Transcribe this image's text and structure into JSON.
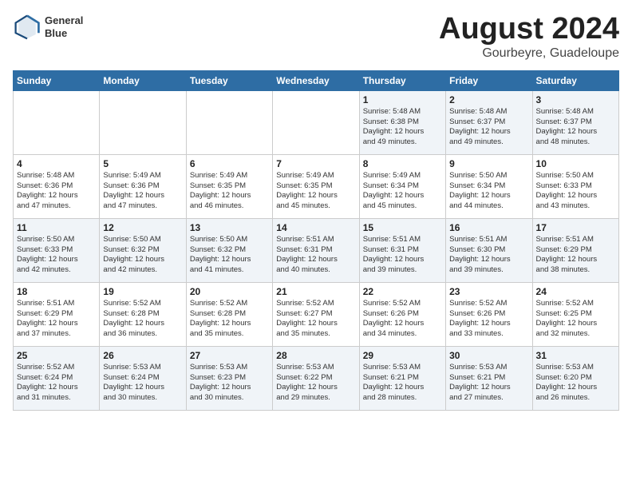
{
  "header": {
    "logo_line1": "General",
    "logo_line2": "Blue",
    "month_year": "August 2024",
    "location": "Gourbeyre, Guadeloupe"
  },
  "days_of_week": [
    "Sunday",
    "Monday",
    "Tuesday",
    "Wednesday",
    "Thursday",
    "Friday",
    "Saturday"
  ],
  "weeks": [
    [
      {
        "day": "",
        "info": ""
      },
      {
        "day": "",
        "info": ""
      },
      {
        "day": "",
        "info": ""
      },
      {
        "day": "",
        "info": ""
      },
      {
        "day": "1",
        "info": "Sunrise: 5:48 AM\nSunset: 6:38 PM\nDaylight: 12 hours\nand 49 minutes."
      },
      {
        "day": "2",
        "info": "Sunrise: 5:48 AM\nSunset: 6:37 PM\nDaylight: 12 hours\nand 49 minutes."
      },
      {
        "day": "3",
        "info": "Sunrise: 5:48 AM\nSunset: 6:37 PM\nDaylight: 12 hours\nand 48 minutes."
      }
    ],
    [
      {
        "day": "4",
        "info": "Sunrise: 5:48 AM\nSunset: 6:36 PM\nDaylight: 12 hours\nand 47 minutes."
      },
      {
        "day": "5",
        "info": "Sunrise: 5:49 AM\nSunset: 6:36 PM\nDaylight: 12 hours\nand 47 minutes."
      },
      {
        "day": "6",
        "info": "Sunrise: 5:49 AM\nSunset: 6:35 PM\nDaylight: 12 hours\nand 46 minutes."
      },
      {
        "day": "7",
        "info": "Sunrise: 5:49 AM\nSunset: 6:35 PM\nDaylight: 12 hours\nand 45 minutes."
      },
      {
        "day": "8",
        "info": "Sunrise: 5:49 AM\nSunset: 6:34 PM\nDaylight: 12 hours\nand 45 minutes."
      },
      {
        "day": "9",
        "info": "Sunrise: 5:50 AM\nSunset: 6:34 PM\nDaylight: 12 hours\nand 44 minutes."
      },
      {
        "day": "10",
        "info": "Sunrise: 5:50 AM\nSunset: 6:33 PM\nDaylight: 12 hours\nand 43 minutes."
      }
    ],
    [
      {
        "day": "11",
        "info": "Sunrise: 5:50 AM\nSunset: 6:33 PM\nDaylight: 12 hours\nand 42 minutes."
      },
      {
        "day": "12",
        "info": "Sunrise: 5:50 AM\nSunset: 6:32 PM\nDaylight: 12 hours\nand 42 minutes."
      },
      {
        "day": "13",
        "info": "Sunrise: 5:50 AM\nSunset: 6:32 PM\nDaylight: 12 hours\nand 41 minutes."
      },
      {
        "day": "14",
        "info": "Sunrise: 5:51 AM\nSunset: 6:31 PM\nDaylight: 12 hours\nand 40 minutes."
      },
      {
        "day": "15",
        "info": "Sunrise: 5:51 AM\nSunset: 6:31 PM\nDaylight: 12 hours\nand 39 minutes."
      },
      {
        "day": "16",
        "info": "Sunrise: 5:51 AM\nSunset: 6:30 PM\nDaylight: 12 hours\nand 39 minutes."
      },
      {
        "day": "17",
        "info": "Sunrise: 5:51 AM\nSunset: 6:29 PM\nDaylight: 12 hours\nand 38 minutes."
      }
    ],
    [
      {
        "day": "18",
        "info": "Sunrise: 5:51 AM\nSunset: 6:29 PM\nDaylight: 12 hours\nand 37 minutes."
      },
      {
        "day": "19",
        "info": "Sunrise: 5:52 AM\nSunset: 6:28 PM\nDaylight: 12 hours\nand 36 minutes."
      },
      {
        "day": "20",
        "info": "Sunrise: 5:52 AM\nSunset: 6:28 PM\nDaylight: 12 hours\nand 35 minutes."
      },
      {
        "day": "21",
        "info": "Sunrise: 5:52 AM\nSunset: 6:27 PM\nDaylight: 12 hours\nand 35 minutes."
      },
      {
        "day": "22",
        "info": "Sunrise: 5:52 AM\nSunset: 6:26 PM\nDaylight: 12 hours\nand 34 minutes."
      },
      {
        "day": "23",
        "info": "Sunrise: 5:52 AM\nSunset: 6:26 PM\nDaylight: 12 hours\nand 33 minutes."
      },
      {
        "day": "24",
        "info": "Sunrise: 5:52 AM\nSunset: 6:25 PM\nDaylight: 12 hours\nand 32 minutes."
      }
    ],
    [
      {
        "day": "25",
        "info": "Sunrise: 5:52 AM\nSunset: 6:24 PM\nDaylight: 12 hours\nand 31 minutes."
      },
      {
        "day": "26",
        "info": "Sunrise: 5:53 AM\nSunset: 6:24 PM\nDaylight: 12 hours\nand 30 minutes."
      },
      {
        "day": "27",
        "info": "Sunrise: 5:53 AM\nSunset: 6:23 PM\nDaylight: 12 hours\nand 30 minutes."
      },
      {
        "day": "28",
        "info": "Sunrise: 5:53 AM\nSunset: 6:22 PM\nDaylight: 12 hours\nand 29 minutes."
      },
      {
        "day": "29",
        "info": "Sunrise: 5:53 AM\nSunset: 6:21 PM\nDaylight: 12 hours\nand 28 minutes."
      },
      {
        "day": "30",
        "info": "Sunrise: 5:53 AM\nSunset: 6:21 PM\nDaylight: 12 hours\nand 27 minutes."
      },
      {
        "day": "31",
        "info": "Sunrise: 5:53 AM\nSunset: 6:20 PM\nDaylight: 12 hours\nand 26 minutes."
      }
    ]
  ]
}
